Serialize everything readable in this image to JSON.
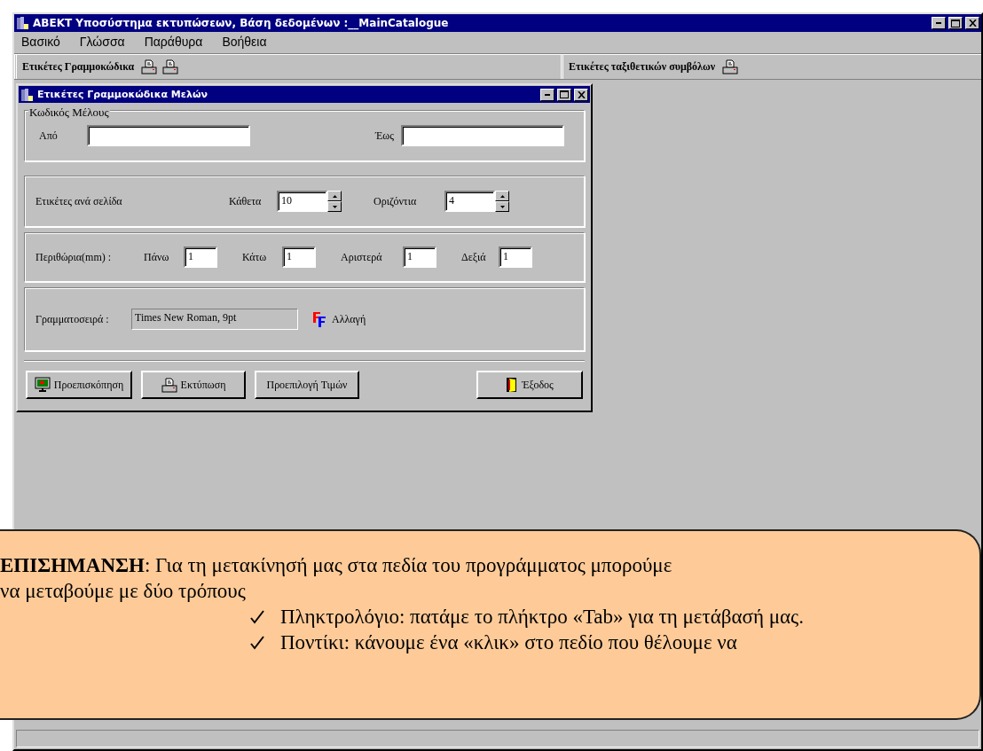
{
  "window": {
    "title": "ABEKT Υποσύστημα εκτυπώσεων, Βάση δεδομένων :__MainCatalogue"
  },
  "menu": [
    "Βασικό",
    "Γλώσσα",
    "Παράθυρα",
    "Βοήθεια"
  ],
  "toolbars": [
    {
      "label": "Ετικέτες Γραμμοκώδικα",
      "icons": [
        {
          "kind": "printer"
        },
        {
          "kind": "printer"
        }
      ]
    },
    {
      "label": "Ετικέτες ταξιθετικών συμβόλων",
      "icons": [
        {
          "kind": "printer"
        }
      ]
    }
  ],
  "dialog": {
    "title": "Ετικέτες Γραμμοκώδικα Μελών",
    "code_group": {
      "legend": "Κωδικός Μέλους",
      "from_label": "Από",
      "to_label": "Έως"
    },
    "per_page": {
      "label": "Ετικέτες ανά σελίδα",
      "fields": [
        {
          "label": "Κάθετα",
          "value": "10"
        },
        {
          "label": "Οριζόντια",
          "value": "4"
        }
      ]
    },
    "margins": {
      "label": "Περιθώρια(mm) :",
      "fields": [
        {
          "label": "Πάνω",
          "value": "1"
        },
        {
          "label": "Κάτω",
          "value": "1"
        },
        {
          "label": "Αριστερά",
          "value": "1"
        },
        {
          "label": "Δεξιά",
          "value": "1"
        }
      ]
    },
    "font": {
      "label": "Γραμματοσειρά :",
      "value": "Times New Roman, 9pt",
      "change": "Αλλαγή"
    },
    "buttons": [
      {
        "kind": "preview",
        "label": "Προεπισκόπηση"
      },
      {
        "kind": "print",
        "label": "Εκτύπωση"
      },
      {
        "kind": "plain",
        "label": "Προεπιλογή Τιμών"
      },
      {
        "kind": "exit",
        "label": "Έξοδος"
      }
    ]
  },
  "callout": {
    "text": "**ΕΠΙΣΗΜΑΝΣΗ**: Για τη μετακίνησή μας στα πεδία του προγράμματος μπορούμε",
    "text_2": "να μεταβούμε με δύο τρόπους",
    "items": [
      "Πληκτρολόγιο: πατάμε το πλήκτρο «Tab» για τη μετάβασή μας.",
      "Ποντίκι: κάνουμε ένα «κλικ» στο πεδίο που θέλουμε να"
    ]
  }
}
